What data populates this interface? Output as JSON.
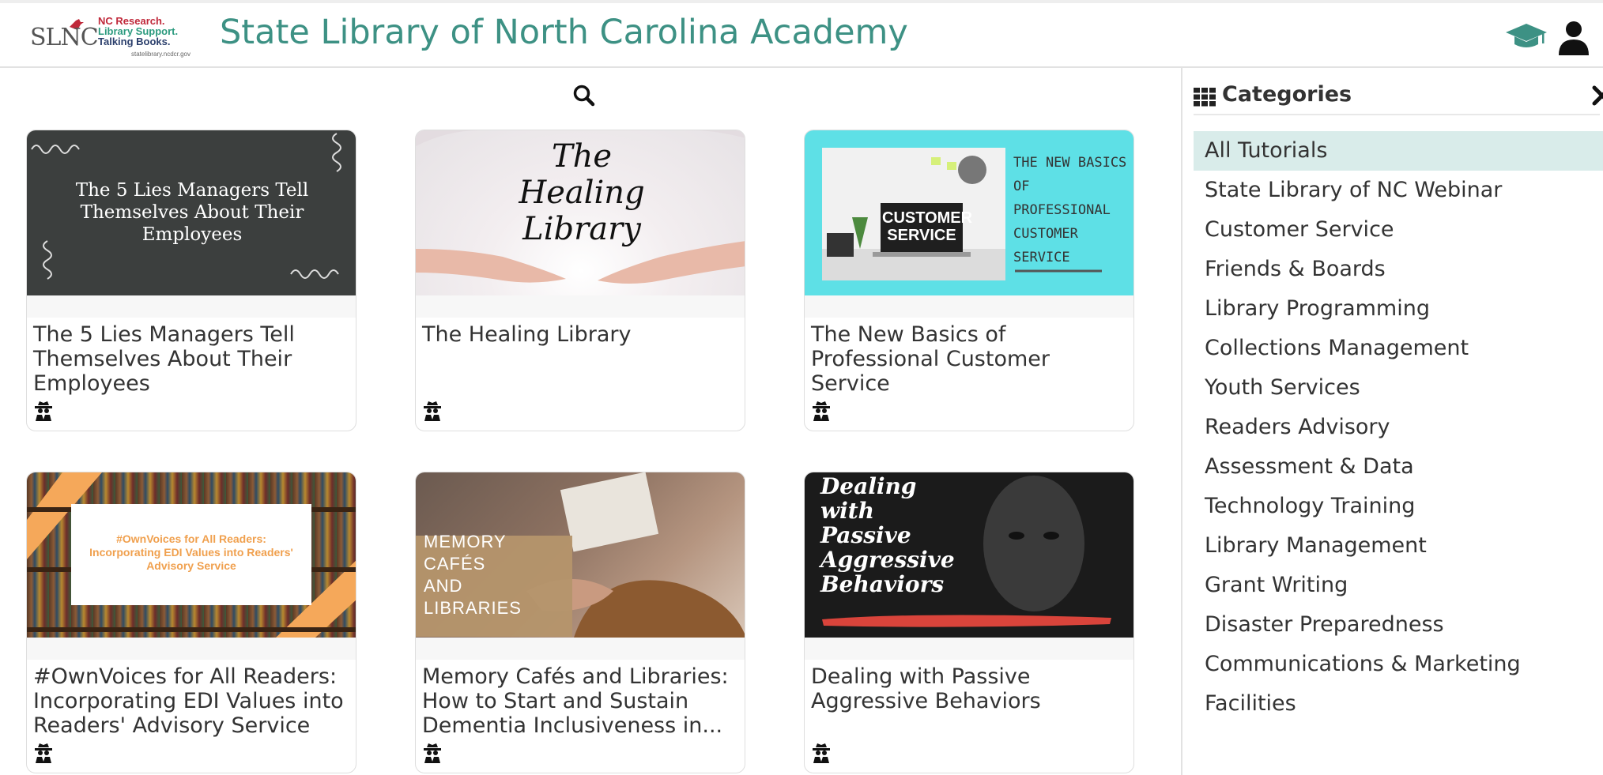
{
  "header": {
    "logo": {
      "wordmark": "SLNC",
      "tagline": [
        "NC Research.",
        "Library Support.",
        "Talking Books."
      ],
      "url": "statelibrary.ncdcr.gov"
    },
    "title": "State Library of North Carolina Academy",
    "icons": [
      "graduation-cap-icon",
      "user-icon"
    ]
  },
  "search": {
    "icon": "search-icon"
  },
  "tutorials": [
    {
      "title": "The 5 Lies Managers Tell Themselves About Their Employees",
      "thumb_text": "The 5 Lies Managers Tell Themselves About Their Employees"
    },
    {
      "title": "The Healing Library",
      "thumb_text": [
        "The",
        "Healing",
        "Library"
      ]
    },
    {
      "title": "The New Basics of Professional Customer Service",
      "thumb_text": [
        "THE NEW BASICS",
        "OF",
        "PROFESSIONAL",
        "CUSTOMER",
        "SERVICE"
      ],
      "thumb_badge": [
        "CUSTOMER",
        "SERVICE"
      ]
    },
    {
      "title": "#OwnVoices for All Readers: Incorporating EDI Values into Readers' Advisory Service",
      "thumb_text": "#OwnVoices for All Readers: Incorporating EDI Values into Readers' Advisory Service"
    },
    {
      "title": "Memory Cafés and Libraries: How to Start and Sustain Dementia Inclusiveness in...",
      "thumb_text": [
        "MEMORY CAFÉS",
        "AND LIBRARIES"
      ]
    },
    {
      "title": "Dealing with Passive Aggressive Behaviors",
      "thumb_text": [
        "Dealing",
        "with",
        "Passive",
        "Aggressive",
        "Behaviors"
      ]
    }
  ],
  "sidebar": {
    "title": "Categories",
    "active_index": 0,
    "items": [
      "All Tutorials",
      "State Library of NC Webinar",
      "Customer Service",
      "Friends & Boards",
      "Library Programming",
      "Collections Management",
      "Youth Services",
      "Readers Advisory",
      "Assessment & Data",
      "Technology Training",
      "Library Management",
      "Grant Writing",
      "Disaster Preparedness",
      "Communications & Marketing",
      "Facilities"
    ]
  },
  "colors": {
    "title_teal": "#3d9184",
    "active_category": "#d9ecea",
    "accent_orange": "#f5a85a",
    "thumb_cyan": "#5ee0e6",
    "red_stroke": "#d9443b"
  }
}
